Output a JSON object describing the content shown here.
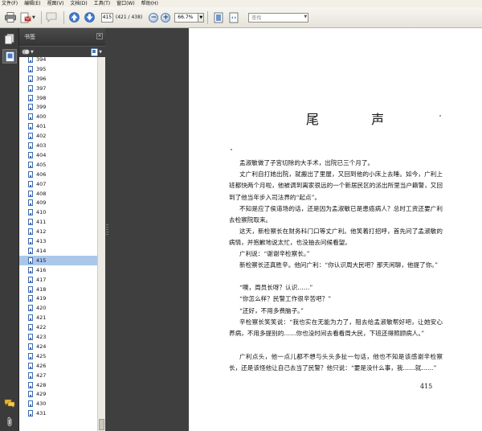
{
  "menu": [
    "文件(F)",
    "编辑(E)",
    "视图(V)",
    "文档(D)",
    "工具(T)",
    "窗口(W)",
    "帮助(H)"
  ],
  "toolbar": {
    "current_page": "415",
    "page_count": "(421 / 438)",
    "zoom": "66.7%",
    "search_placeholder": "查找"
  },
  "bookmarks": {
    "title": "书签",
    "items": [
      "394",
      "395",
      "396",
      "397",
      "398",
      "399",
      "400",
      "401",
      "402",
      "403",
      "404",
      "405",
      "406",
      "407",
      "408",
      "409",
      "410",
      "411",
      "412",
      "413",
      "414",
      "415",
      "416",
      "417",
      "418",
      "419",
      "420",
      "421",
      "422",
      "423",
      "424",
      "425",
      "426",
      "427",
      "428",
      "429",
      "430",
      "431"
    ],
    "selected": "415"
  },
  "document": {
    "chapter_title": "尾 声",
    "paragraphs": [
      "孟淑敏做了子宫切除的大手术，出院已三个月了。",
      "丈广利自打她出院，就搬出了里屋，又回到他的小床上去睡。如今，广利上班都快两个月啦，他被调到离家很远的一个新居民区的派出所里当户籍警，又回到了他当年步入司法界的“起点”。",
      "不知是应了侯道场的话，还是因为孟淑敏已是患癌病人？总时工资还要广利去检察院取来。",
      "这天，新检察长在财务科门口等丈广利。他笑着打招呼，首先问了孟淑敏的病情，并抱歉地说太忙，也没抽去问候看望。",
      "广利说：“谢谢辛检察长。”",
      "新检察长还真胜辛。他问广利：“你认识周大民吧？那天闲聊，他提了你。”",
      "“噢，周员长呀？认识……”",
      "“你怎么样？民警工作很辛苦吧？”",
      "“还好，不用多费脑子。”",
      "辛检察长笑笑说：“我也实在无能为力了，阻去给孟淑敏帮好吧，让她安心养病，不用多提别的……你也没时间去看看周大民，下班还得照顾病人。”",
      "广利点头，他一点儿都不想与头头多扯一句话，他也不知是该感谢辛检察长，还是该怪他让自己去当了民警？他只说：“要是没什么事，我……就……”"
    ],
    "page_number": "415"
  }
}
